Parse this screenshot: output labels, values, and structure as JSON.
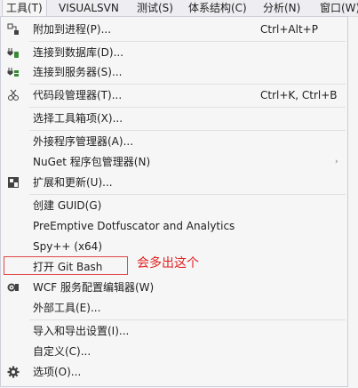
{
  "menubar": {
    "items": [
      "工具(T)",
      "VISUALSVN",
      "测试(S)",
      "体系结构(C)",
      "分析(N)",
      "窗口(W)"
    ]
  },
  "menu": {
    "items": [
      {
        "label": "附加到进程(P)...",
        "shortcut": "Ctrl+Alt+P",
        "icon": "attach-process-icon"
      },
      {
        "label": "连接到数据库(D)...",
        "icon": "connect-database-icon"
      },
      {
        "label": "连接到服务器(S)...",
        "icon": "connect-server-icon"
      },
      {
        "label": "代码段管理器(T)...",
        "shortcut": "Ctrl+K, Ctrl+B",
        "icon": "snippets-icon"
      },
      {
        "label": "选择工具箱项(X)..."
      },
      {
        "label": "外接程序管理器(A)..."
      },
      {
        "label": "NuGet 程序包管理器(N)",
        "has_submenu": true,
        "arrow": "›"
      },
      {
        "label": "扩展和更新(U)...",
        "icon": "extensions-icon"
      },
      {
        "label": "创建 GUID(G)"
      },
      {
        "label": "PreEmptive Dotfuscator and Analytics"
      },
      {
        "label": "Spy++ (x64)"
      },
      {
        "label": "打开 Git Bash"
      },
      {
        "label": "WCF 服务配置编辑器(W)",
        "icon": "wcf-config-icon"
      },
      {
        "label": "外部工具(E)..."
      },
      {
        "label": "导入和导出设置(I)..."
      },
      {
        "label": "自定义(C)..."
      },
      {
        "label": "选项(O)...",
        "icon": "gear-icon"
      }
    ]
  },
  "annotation": {
    "text": "会多出这个",
    "color": "#e02020"
  }
}
